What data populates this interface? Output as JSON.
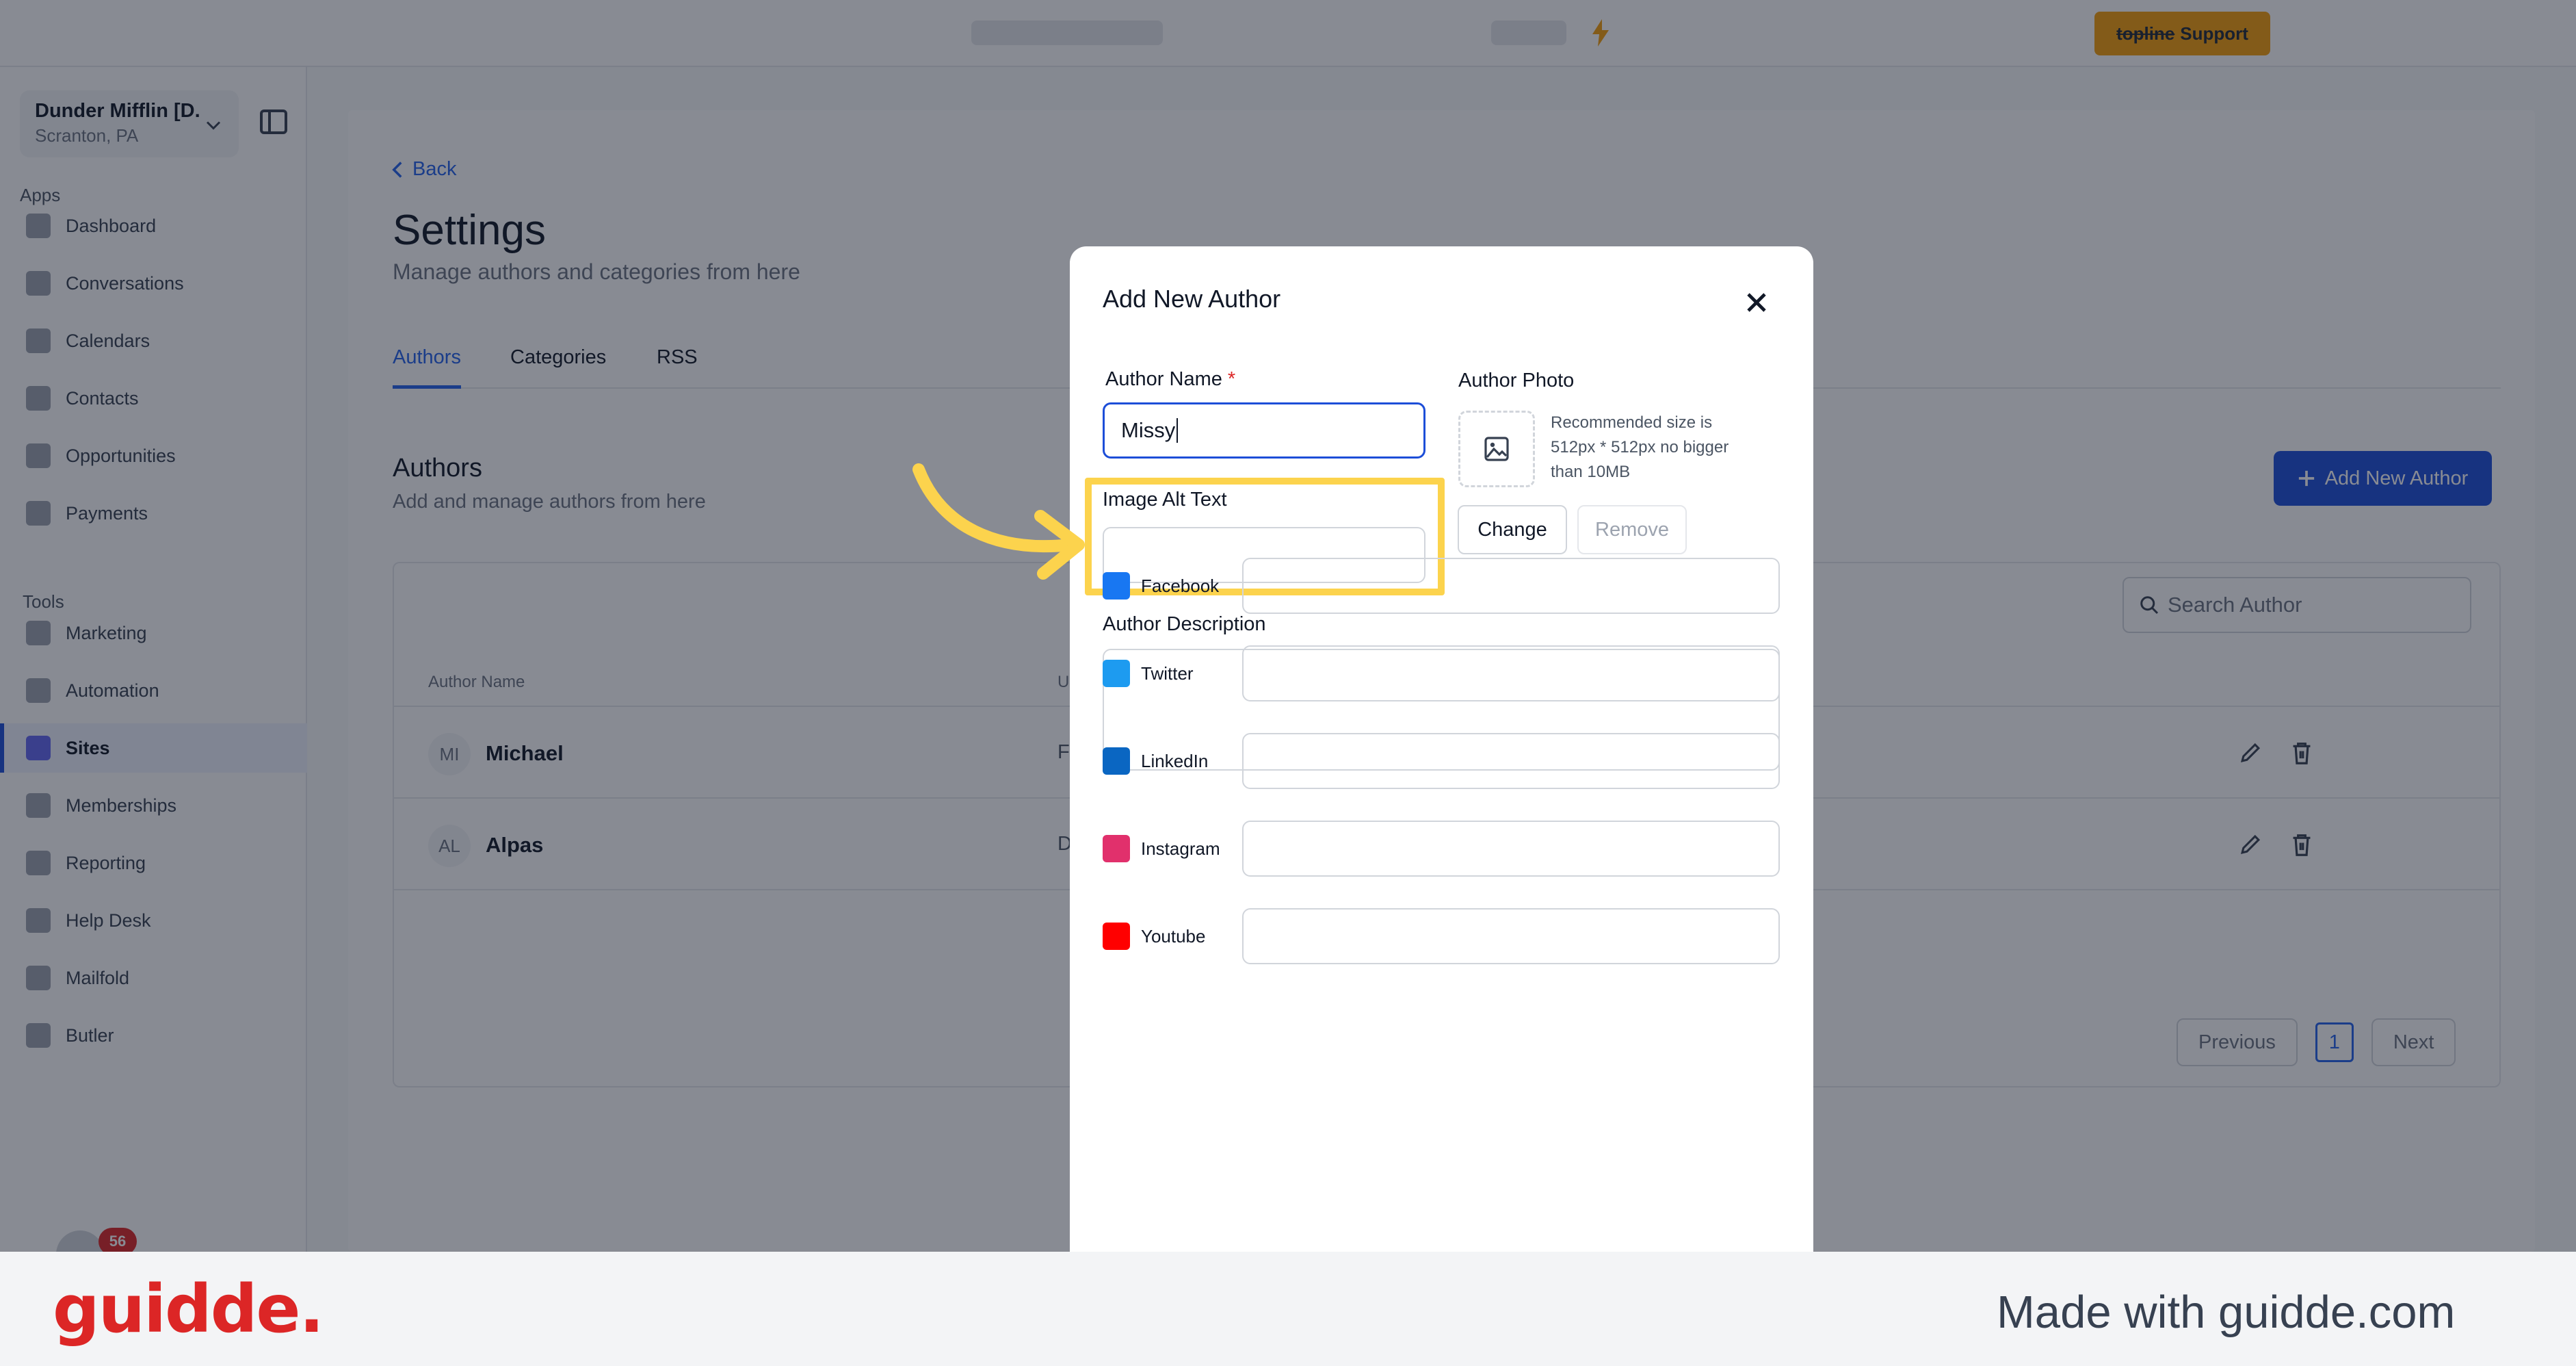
{
  "topbar": {
    "support_brand": "topline",
    "support_label": "Support"
  },
  "sidebar": {
    "location_name": "Dunder Mifflin [D...",
    "location_sub": "Scranton, PA",
    "apps_heading": "Apps",
    "tools_heading": "Tools",
    "apps": [
      "Dashboard",
      "Conversations",
      "Calendars",
      "Contacts",
      "Opportunities",
      "Payments"
    ],
    "tools": [
      "Marketing",
      "Automation",
      "Sites",
      "Memberships",
      "Reporting",
      "Help Desk",
      "Mailfold",
      "Butler"
    ],
    "active_item": "Sites",
    "notification_count": "56"
  },
  "main": {
    "back_label": "Back",
    "title": "Settings",
    "subtitle": "Manage authors and categories from here",
    "tabs": [
      "Authors",
      "Categories",
      "RSS"
    ],
    "active_tab": "Authors",
    "section_title": "Authors",
    "section_subtitle": "Add and manage authors from here",
    "add_button": "Add New Author",
    "search_placeholder": "Search Author",
    "table_header": [
      "Author Name",
      "U"
    ],
    "rows": [
      {
        "initials": "MI",
        "name": "Michael",
        "col2": "Fe"
      },
      {
        "initials": "AL",
        "name": "Alpas",
        "col2": "D"
      }
    ],
    "pagination": {
      "previous": "Previous",
      "page": "1",
      "next": "Next"
    }
  },
  "modal": {
    "title": "Add New Author",
    "author_name_label": "Author Name",
    "required_mark": "*",
    "author_name_value": "Missy",
    "author_photo_label": "Author Photo",
    "photo_hint": "Recommended size is 512px * 512px no bigger than 10MB",
    "change_button": "Change",
    "remove_button": "Remove",
    "alt_text_label": "Image Alt Text",
    "alt_text_value": "",
    "description_label": "Author Description",
    "socials": [
      {
        "label": "Facebook",
        "color": "#1877f2"
      },
      {
        "label": "Twitter",
        "color": "#1d9bf0"
      },
      {
        "label": "LinkedIn",
        "color": "#0a66c2"
      },
      {
        "label": "Instagram",
        "color": "#e1306c"
      },
      {
        "label": "Youtube",
        "color": "#ff0000"
      }
    ]
  },
  "annotation": {
    "highlight_color": "#fcd34d"
  },
  "footer": {
    "logo": "guidde.",
    "tagline": "Made with guidde.com"
  }
}
